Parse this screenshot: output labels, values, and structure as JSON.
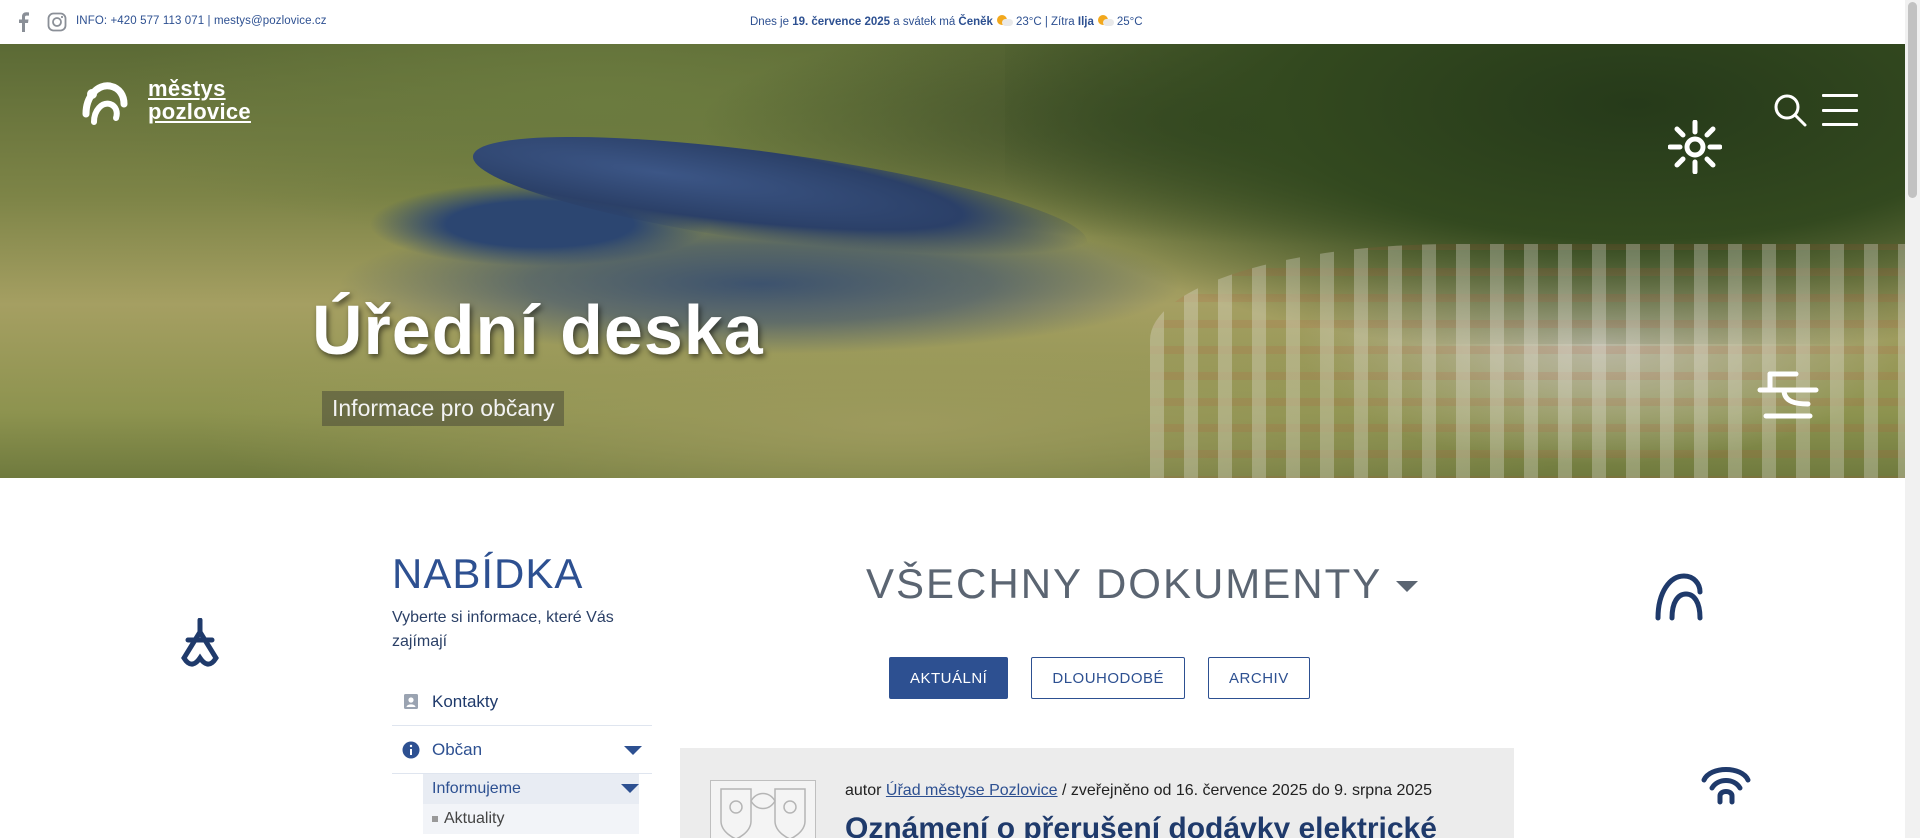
{
  "topbar": {
    "social": [
      "facebook-icon",
      "instagram-icon"
    ],
    "info_prefix": "INFO: ",
    "phone": "+420 577 113 071",
    "separator": " | ",
    "email": "mestys@pozlovice.cz",
    "today_prefix": "Dnes je ",
    "today_date": "19. července 2025",
    "today_mid": " a svátek má ",
    "today_name": "Čeněk",
    "today_temp": "23°C",
    "tomorrow_prefix": " | Zítra ",
    "tomorrow_name": "Ilja",
    "tomorrow_temp": "25°C"
  },
  "brand": {
    "line1": "městys",
    "line2": "pozlovice"
  },
  "hero": {
    "title": "Úřední deska",
    "subtitle": "Informace pro občany"
  },
  "sidebar": {
    "heading": "NABÍDKA",
    "lead": "Vyberte si informace, které Vás zajímají",
    "items": [
      {
        "label": "Kontakty",
        "icon": "contact-card-icon"
      },
      {
        "label": "Občan",
        "icon": "info-icon"
      }
    ],
    "subhead": "Informujeme",
    "subitems": [
      "Aktuality"
    ]
  },
  "documents": {
    "title": "VŠECHNY DOKUMENTY",
    "tabs": [
      {
        "label": "AKTUÁLNÍ",
        "active": true
      },
      {
        "label": "DLOUHODOBÉ",
        "active": false
      },
      {
        "label": "ARCHIV",
        "active": false
      }
    ]
  },
  "card": {
    "author_prefix": "autor ",
    "author": "Úřad městyse Pozlovice",
    "published": " / zveřejněno od 16. července 2025 do 9. srpna 2025",
    "title": "Oznámení o přerušení dodávky elektrické"
  },
  "colors": {
    "primary": "#2d5091",
    "dark": "#1f3a6b",
    "muted": "#5b6572"
  }
}
